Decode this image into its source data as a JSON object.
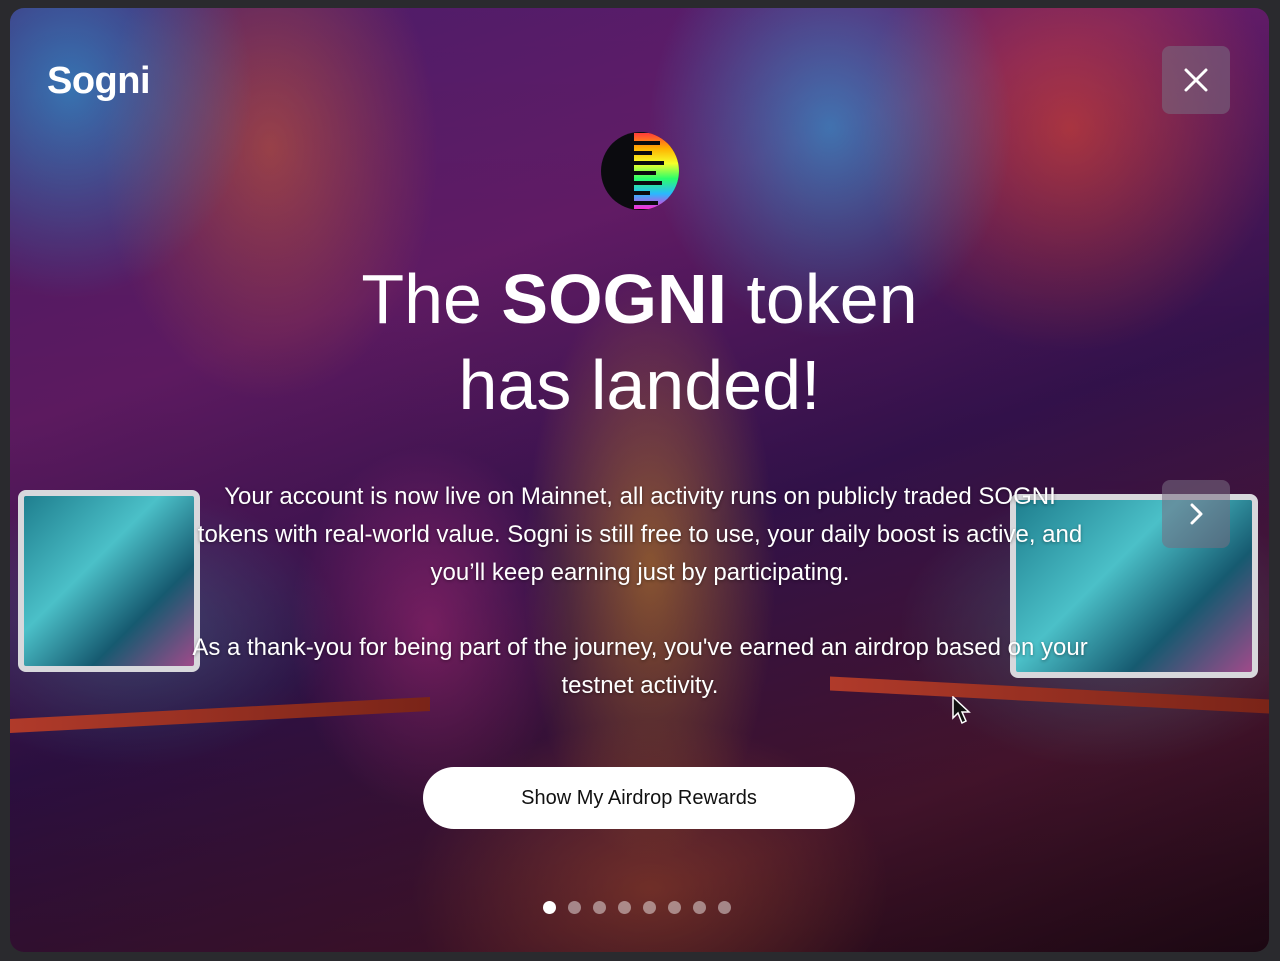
{
  "brand": {
    "logo_text": "Sogni"
  },
  "headline": {
    "line1_prefix": "The ",
    "line1_bold": "SOGNI",
    "line1_suffix": " token",
    "line2": "has landed!"
  },
  "body": {
    "paragraph1": "Your account is now live on Mainnet, all activity runs on publicly traded SOGNI tokens with real-world value. Sogni is still free to use, your daily boost is active, and you’ll keep earning just by participating.",
    "paragraph2": "As a thank-you for being part of the journey, you've earned an airdrop based on your testnet activity."
  },
  "cta": {
    "label": "Show My Airdrop Rewards"
  },
  "controls": {
    "close_icon": "close-icon",
    "next_icon": "chevron-right-icon"
  },
  "pagination": {
    "total": 8,
    "active_index": 0
  },
  "colors": {
    "accent_white": "#ffffff",
    "control_bg": "#786e82",
    "cta_text": "#111111"
  }
}
